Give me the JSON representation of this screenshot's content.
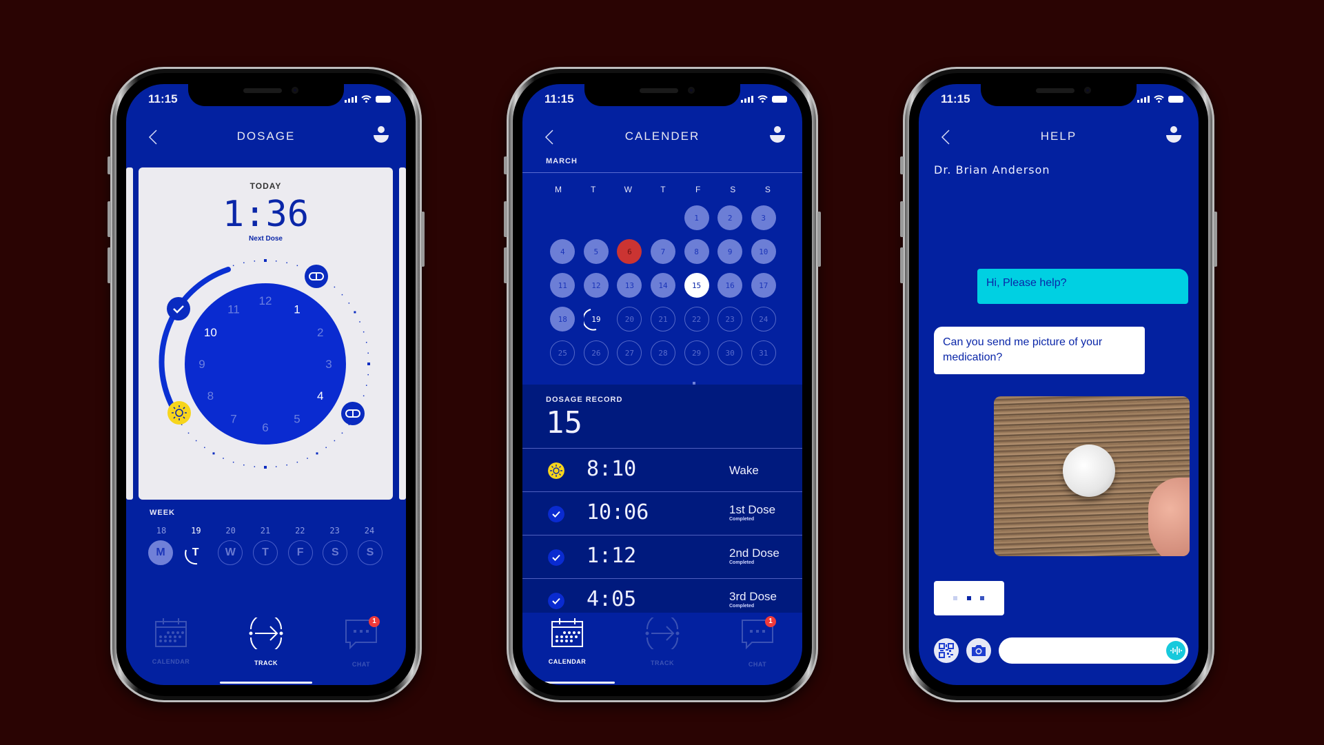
{
  "colors": {
    "background": "#2a0403",
    "screen": "#0321a0",
    "record_band": "#001a7e",
    "accent_cyan": "#00d0e2",
    "wake_yellow": "#f7d51c",
    "missed_red": "#cb3432",
    "badge_red": "#f03a3a",
    "card": "#ecebf0"
  },
  "status_bar": {
    "time": "11:15"
  },
  "phones": {
    "dosage": {
      "title": "DOSAGE",
      "card": {
        "label": "TODAY",
        "countdown": "1:36",
        "sublabel": "Next Dose"
      },
      "dial": {
        "numbers": [
          "12",
          "1",
          "2",
          "3",
          "4",
          "5",
          "6",
          "7",
          "8",
          "9",
          "10",
          "11"
        ],
        "highlighted": [
          "1",
          "10",
          "4"
        ],
        "icons": [
          "pill-icon",
          "check-icon",
          "sun-icon",
          "pill-icon"
        ]
      },
      "week": {
        "label": "WEEK",
        "dates": [
          "18",
          "19",
          "20",
          "21",
          "22",
          "23",
          "24"
        ],
        "days": [
          "M",
          "T",
          "W",
          "T",
          "F",
          "S",
          "S"
        ],
        "current_index": 1,
        "done_index": 0
      },
      "tabs": [
        {
          "label": "CALENDAR",
          "icon": "calendar-icon",
          "active": false
        },
        {
          "label": "TRACK",
          "icon": "track-icon",
          "active": true
        },
        {
          "label": "CHAT",
          "icon": "chat-icon",
          "active": false,
          "badge": "1"
        }
      ]
    },
    "calendar": {
      "title": "CALENDER",
      "month": "MARCH",
      "weekdays": [
        "M",
        "T",
        "W",
        "T",
        "F",
        "S",
        "S"
      ],
      "leading_blanks": 4,
      "days": [
        {
          "d": "1",
          "s": "past"
        },
        {
          "d": "2",
          "s": "past"
        },
        {
          "d": "3",
          "s": "past"
        },
        {
          "d": "4",
          "s": "past"
        },
        {
          "d": "5",
          "s": "past"
        },
        {
          "d": "6",
          "s": "missed"
        },
        {
          "d": "7",
          "s": "past"
        },
        {
          "d": "8",
          "s": "past"
        },
        {
          "d": "9",
          "s": "past"
        },
        {
          "d": "10",
          "s": "past"
        },
        {
          "d": "11",
          "s": "past"
        },
        {
          "d": "12",
          "s": "past"
        },
        {
          "d": "13",
          "s": "past"
        },
        {
          "d": "14",
          "s": "past"
        },
        {
          "d": "15",
          "s": "sel"
        },
        {
          "d": "16",
          "s": "past"
        },
        {
          "d": "17",
          "s": "past"
        },
        {
          "d": "18",
          "s": "past"
        },
        {
          "d": "19",
          "s": "cur"
        },
        {
          "d": "20",
          "s": "fut"
        },
        {
          "d": "21",
          "s": "fut"
        },
        {
          "d": "22",
          "s": "fut"
        },
        {
          "d": "23",
          "s": "fut"
        },
        {
          "d": "24",
          "s": "fut"
        },
        {
          "d": "25",
          "s": "fut"
        },
        {
          "d": "26",
          "s": "fut"
        },
        {
          "d": "27",
          "s": "fut"
        },
        {
          "d": "28",
          "s": "fut"
        },
        {
          "d": "29",
          "s": "fut"
        },
        {
          "d": "30",
          "s": "fut"
        },
        {
          "d": "31",
          "s": "fut"
        }
      ],
      "record": {
        "label": "DOSAGE RECORD",
        "day": "15",
        "entries": [
          {
            "icon": "sun-icon",
            "time": "8:10",
            "label": "Wake",
            "status": ""
          },
          {
            "icon": "check-icon",
            "time": "10:06",
            "label": "1st Dose",
            "status": "Completed"
          },
          {
            "icon": "check-icon",
            "time": "1:12",
            "label": "2nd Dose",
            "status": "Completed"
          },
          {
            "icon": "check-icon",
            "time": "4:05",
            "label": "3rd Dose",
            "status": "Completed"
          }
        ]
      },
      "tabs": [
        {
          "label": "CALENDAR",
          "icon": "calendar-icon",
          "active": true
        },
        {
          "label": "TRACK",
          "icon": "track-icon",
          "active": false
        },
        {
          "label": "CHAT",
          "icon": "chat-icon",
          "active": false,
          "badge": "1"
        }
      ]
    },
    "help": {
      "title": "HELP",
      "contact": "Dr. Brian Anderson",
      "messages": [
        {
          "from": "me",
          "text": "Hi, Please help?"
        },
        {
          "from": "doctor",
          "text": "Can you send me picture of your medication?"
        },
        {
          "from": "me",
          "type": "photo",
          "alt": "white pill on wooden table"
        }
      ],
      "typing_indicator": true,
      "input": {
        "value": "",
        "placeholder": ""
      },
      "buttons": {
        "qr": "qr-code-icon",
        "camera": "camera-icon",
        "voice": "voice-icon"
      }
    }
  }
}
